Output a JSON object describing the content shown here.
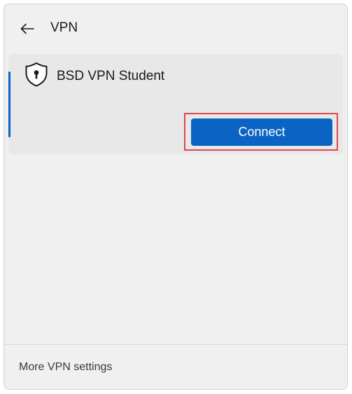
{
  "header": {
    "back_icon": "back-arrow-icon",
    "title": "VPN"
  },
  "vpn_list": [
    {
      "name": "BSD VPN Student",
      "icon": "shield-lock-icon",
      "selected": true,
      "action_label": "Connect"
    }
  ],
  "footer": {
    "link_label": "More VPN settings"
  },
  "colors": {
    "panel_background": "#f0f0f0",
    "card_background": "#e8e8e8",
    "accent": "#0b64c4",
    "highlight_border": "#e0474c"
  }
}
